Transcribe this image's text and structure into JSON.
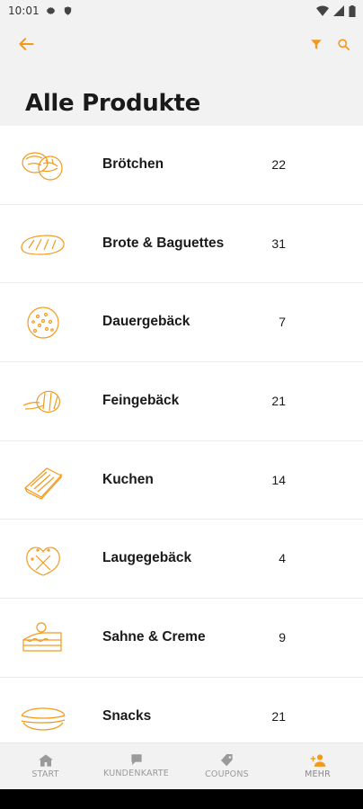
{
  "status": {
    "time": "10:01"
  },
  "colors": {
    "accent": "#f29a1d",
    "background": "#f2f2f2",
    "text": "#1a1a1a"
  },
  "header": {
    "title": "Alle Produkte",
    "back_icon": "arrow-left-icon",
    "filter_icon": "filter-icon",
    "search_icon": "search-icon"
  },
  "products": [
    {
      "label": "Brötchen",
      "count": "22",
      "icon": "bread-rolls-icon"
    },
    {
      "label": "Brote & Baguettes",
      "count": "31",
      "icon": "loaf-icon"
    },
    {
      "label": "Dauergebäck",
      "count": "7",
      "icon": "cookie-icon"
    },
    {
      "label": "Feingebäck",
      "count": "21",
      "icon": "croissant-icon"
    },
    {
      "label": "Kuchen",
      "count": "14",
      "icon": "cake-slice-icon"
    },
    {
      "label": "Laugegebäck",
      "count": "4",
      "icon": "pretzel-icon"
    },
    {
      "label": "Sahne & Creme",
      "count": "9",
      "icon": "cream-cake-icon"
    },
    {
      "label": "Snacks",
      "count": "21",
      "icon": "sandwich-icon"
    }
  ],
  "nav": [
    {
      "label": "START",
      "icon": "home-icon"
    },
    {
      "label": "KUNDENKARTE",
      "icon": "card-icon"
    },
    {
      "label": "COUPONS",
      "icon": "tag-icon"
    },
    {
      "label": "MEHR",
      "icon": "add-person-icon"
    }
  ]
}
